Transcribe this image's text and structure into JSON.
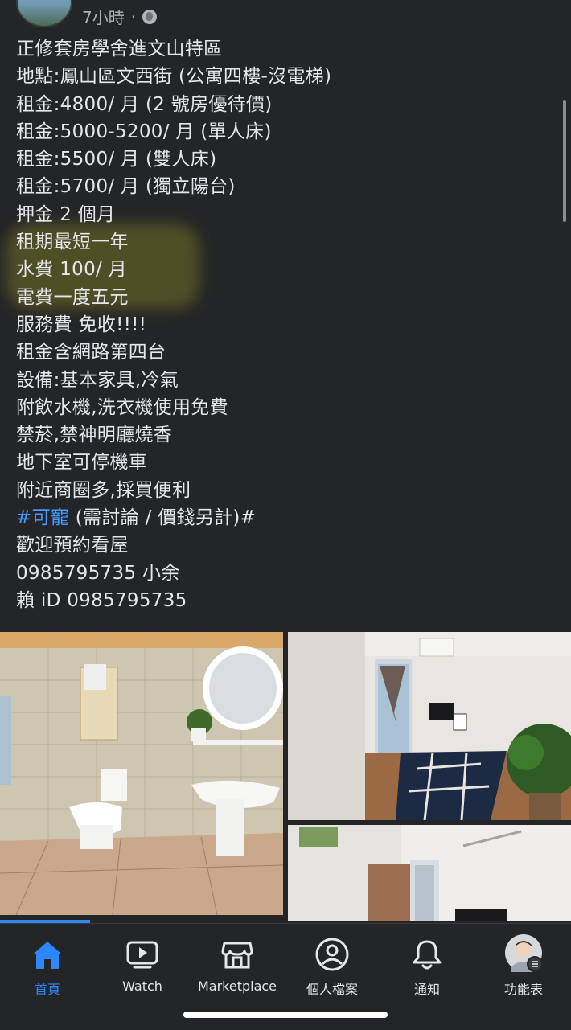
{
  "post": {
    "timestamp": "7小時",
    "separator": "·",
    "lines": [
      "正修套房學舍進文山特區",
      "地點:鳳山區文西街 (公寓四樓-沒電梯)",
      "租金:4800/ 月 (2 號房優待價)",
      "租金:5000-5200/ 月 (單人床)",
      "租金:5500/ 月 (雙人床)",
      "租金:5700/ 月 (獨立陽台)",
      "押金 2 個月",
      "租期最短一年",
      "水費 100/ 月",
      "電費一度五元",
      "服務費  免收!!!!",
      "租金含網路第四台",
      "設備:基本家具,冷氣",
      "附飲水機,洗衣機使用免費",
      "禁菸,禁神明廳燒香",
      "地下室可停機車",
      "附近商圈多,採買便利"
    ],
    "hashtag": "#可寵",
    "hashtag_suffix": " (需討論 / 價錢另計)#",
    "lines_after": [
      "歡迎預約看屋",
      "0985795735 小余",
      "賴 iD 0985795735"
    ]
  },
  "tabs": [
    {
      "label": "首頁",
      "icon": "home-icon",
      "active": true
    },
    {
      "label": "Watch",
      "icon": "watch-icon",
      "active": false
    },
    {
      "label": "Marketplace",
      "icon": "marketplace-icon",
      "active": false
    },
    {
      "label": "個人檔案",
      "icon": "profile-icon",
      "active": false
    },
    {
      "label": "通知",
      "icon": "bell-icon",
      "active": false
    },
    {
      "label": "功能表",
      "icon": "menu-avatar-icon",
      "active": false
    }
  ],
  "colors": {
    "background": "#242526",
    "text": "#e4e6eb",
    "accent": "#2d88ff",
    "hashtag": "#4599ff"
  }
}
